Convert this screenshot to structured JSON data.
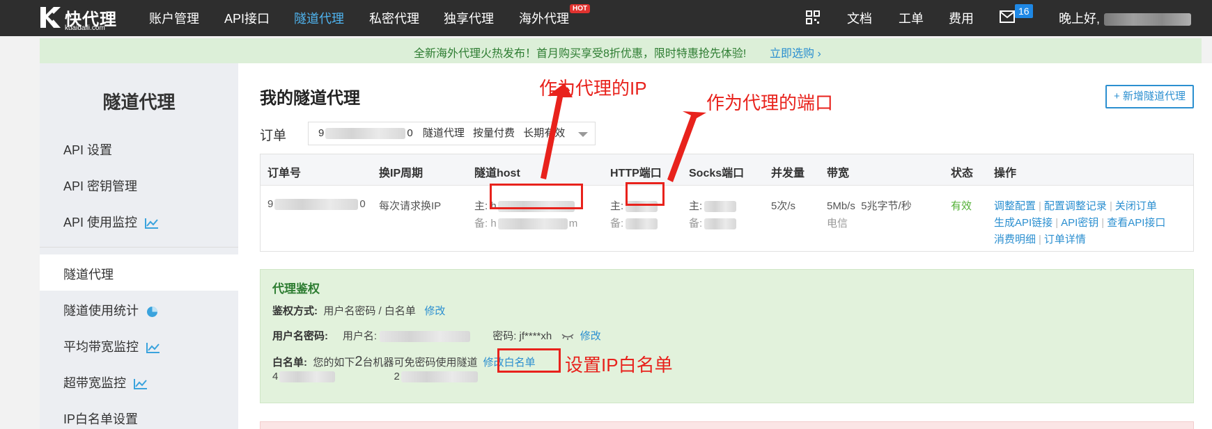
{
  "topbar": {
    "logo_text": "快代理",
    "logo_sub": "kuaidaili.com",
    "nav": [
      "账户管理",
      "API接口",
      "隧道代理",
      "私密代理",
      "独享代理",
      "海外代理"
    ],
    "hot_badge": "HOT",
    "right": {
      "docs": "文档",
      "tickets": "工单",
      "fees": "费用",
      "mail_count": "16",
      "greeting": "晚上好,"
    }
  },
  "notice": {
    "text": "全新海外代理火热发布！首月购买享受8折优惠，限时特惠抢先体验!",
    "link": "立即选购 ›",
    "close": "✕"
  },
  "sidebar": {
    "title": "隧道代理",
    "items": [
      "API 设置",
      "API 密钥管理",
      "API 使用监控",
      "隧道代理",
      "隧道使用统计",
      "平均带宽监控",
      "超带宽监控",
      "IP白名单设置"
    ]
  },
  "main": {
    "title": "我的隧道代理",
    "add_button": "+ 新增隧道代理",
    "order_label": "订单",
    "order_select": {
      "prefix": "9",
      "suffix": "0",
      "type": "隧道代理",
      "billing": "按量付费",
      "duration": "长期有效"
    }
  },
  "table": {
    "headers": [
      "订单号",
      "换IP周期",
      "隧道host",
      "HTTP端口",
      "Socks端口",
      "并发量",
      "带宽",
      "状态",
      "操作"
    ],
    "row": {
      "order_prefix": "9",
      "order_suffix": "0",
      "cycle": "每次请求换IP",
      "host_main_label": "主: h",
      "host_backup_label": "备: h",
      "host_backup_suffix": "m",
      "http_main_label": "主:",
      "http_backup_label": "备:",
      "socks_main_label": "主:",
      "socks_backup_label": "备:",
      "concurrency": "5次/s",
      "bandwidth": "5Mb/s",
      "bandwidth_note": "5兆字节/秒",
      "carrier": "电信",
      "status": "有效",
      "actions_line1": [
        "调整配置",
        "配置调整记录",
        "关闭订单"
      ],
      "actions_line2": [
        "生成API链接",
        "API密钥",
        "查看API接口"
      ],
      "actions_line3": [
        "消费明细",
        "订单详情"
      ]
    }
  },
  "auth": {
    "title": "代理鉴权",
    "method_label": "鉴权方式:",
    "method_value": "用户名密码 / 白名单",
    "modify": "修改",
    "userpass_label": "用户名密码:",
    "username_label": "用户名:",
    "password_label": "密码:",
    "password_value": "jf****xh",
    "whitelist_label": "白名单:",
    "whitelist_text_a": "您的如下",
    "whitelist_count": "2",
    "whitelist_text_b": "台机器可免密码使用隧道",
    "whitelist_modify": "修改白名单",
    "whitelist_ip_1": "4",
    "whitelist_ip_2": "2"
  },
  "annotations": {
    "proxy_ip": "作为代理的IP",
    "proxy_port": "作为代理的端口",
    "set_whitelist": "设置IP白名单"
  },
  "colors": {
    "accent": "#2b8fd0",
    "annotation": "#e8221c",
    "topbar": "#2e2e2e",
    "status_ok": "#52b035"
  }
}
